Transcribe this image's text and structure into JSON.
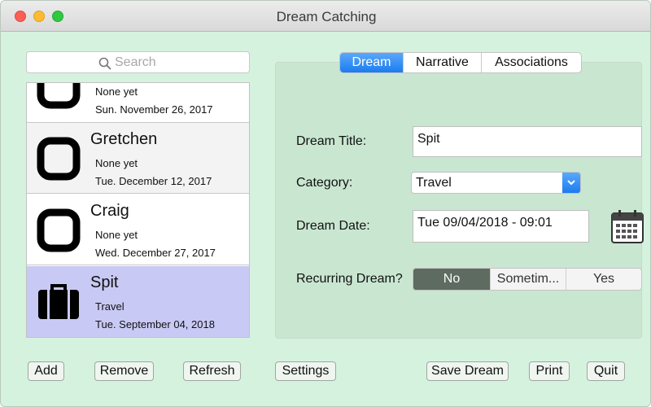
{
  "window": {
    "title": "Dream Catching"
  },
  "search": {
    "placeholder": "Search"
  },
  "list": {
    "items": [
      {
        "name": "",
        "category": "None yet",
        "date": "Sun. November 26, 2017",
        "icon": "rounded-square-icon"
      },
      {
        "name": "Gretchen",
        "category": "None yet",
        "date": "Tue. December 12, 2017",
        "icon": "rounded-square-icon"
      },
      {
        "name": "Craig",
        "category": "None yet",
        "date": "Wed. December 27, 2017",
        "icon": "rounded-square-icon"
      },
      {
        "name": "Spit",
        "category": "Travel",
        "date": "Tue. September 04, 2018",
        "icon": "suitcase-icon"
      }
    ]
  },
  "tabs": [
    {
      "label": "Dream",
      "active": true
    },
    {
      "label": "Narrative",
      "active": false
    },
    {
      "label": "Associations",
      "active": false
    }
  ],
  "form": {
    "title_label": "Dream Title:",
    "title_value": "Spit",
    "category_label": "Category:",
    "category_value": "Travel",
    "date_label": "Dream Date:",
    "date_value": "Tue 09/04/2018 - 09:01",
    "recurring_label": "Recurring Dream?",
    "recurring_options": [
      "No",
      "Sometim...",
      "Yes"
    ],
    "recurring_selected": "No"
  },
  "buttons": {
    "add": "Add",
    "remove": "Remove",
    "refresh": "Refresh",
    "settings": "Settings",
    "save": "Save Dream",
    "print": "Print",
    "quit": "Quit"
  },
  "colors": {
    "window_bg": "#d5f2df",
    "panel_bg": "#c9e6d1",
    "selected_row": "#c9c9f5",
    "accent_blue": "#1b7cf0",
    "segment_selected": "#5e6b60"
  }
}
